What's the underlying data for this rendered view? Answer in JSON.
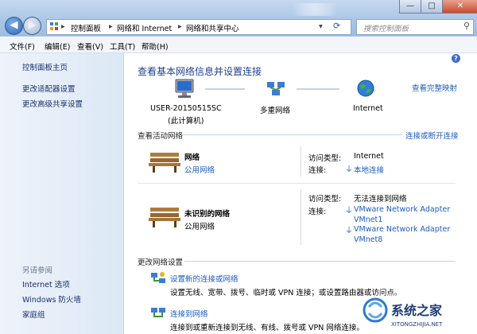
{
  "nav": {
    "back_icon": "back-arrow-icon",
    "forward_icon": "forward-arrow-icon"
  },
  "address": {
    "crumbs": [
      "控制面板",
      "网络和 Internet",
      "网络和共享中心"
    ]
  },
  "search": {
    "placeholder": "搜索控制面板"
  },
  "window_buttons": {
    "minimize": "—",
    "maximize": "□",
    "close": "✕"
  },
  "menu": {
    "items": [
      "文件(F)",
      "编辑(E)",
      "查看(V)",
      "工具(T)",
      "帮助(H)"
    ]
  },
  "sidebar": {
    "items": [
      "控制面板主页",
      "更改适配器设置",
      "更改高级共享设置"
    ],
    "see_also": {
      "heading": "另请参阅",
      "items": [
        "Internet 选项",
        "Windows 防火墙",
        "家庭组"
      ]
    }
  },
  "main": {
    "title": "查看基本网络信息并设置连接",
    "view_full_map": "查看完整映射",
    "map": {
      "computer": "USER-20150515SC",
      "computer_sub": "(此计算机)",
      "middle": "多重网络",
      "internet": "Internet"
    },
    "active_heading": "查看活动网络",
    "connect_disconnect": "连接或断开连接",
    "networks": [
      {
        "name": "网络",
        "category": "公用网络",
        "access_label": "访问类型:",
        "access_value": "Internet",
        "conn_label": "连接:",
        "connections": [
          "本地连接"
        ]
      },
      {
        "name": "未识别的网络",
        "category": "公用网络",
        "access_label": "访问类型:",
        "access_value": "无法连接到网络",
        "conn_label": "连接:",
        "connections": [
          "VMware Network Adapter",
          "VMnet1",
          "VMware Network Adapter",
          "VMnet8"
        ]
      }
    ],
    "change_heading": "更改网络设置",
    "tasks": [
      {
        "link": "设置新的连接或网络",
        "desc": "设置无线、宽带、拨号、临时或 VPN 连接；或设置路由器或访问点。"
      },
      {
        "link": "连接到网络",
        "desc": "连接到或重新连接到无线、有线、拨号或 VPN 网络连接。"
      }
    ]
  },
  "watermark": {
    "text": "系统之家",
    "url": "XITONGZHIJIA.NET"
  },
  "colors": {
    "link": "#1c5bbf",
    "title": "#1e3f8e",
    "sidebar_bg": "#e4edf8",
    "titlebar": "#b4cbe8"
  }
}
